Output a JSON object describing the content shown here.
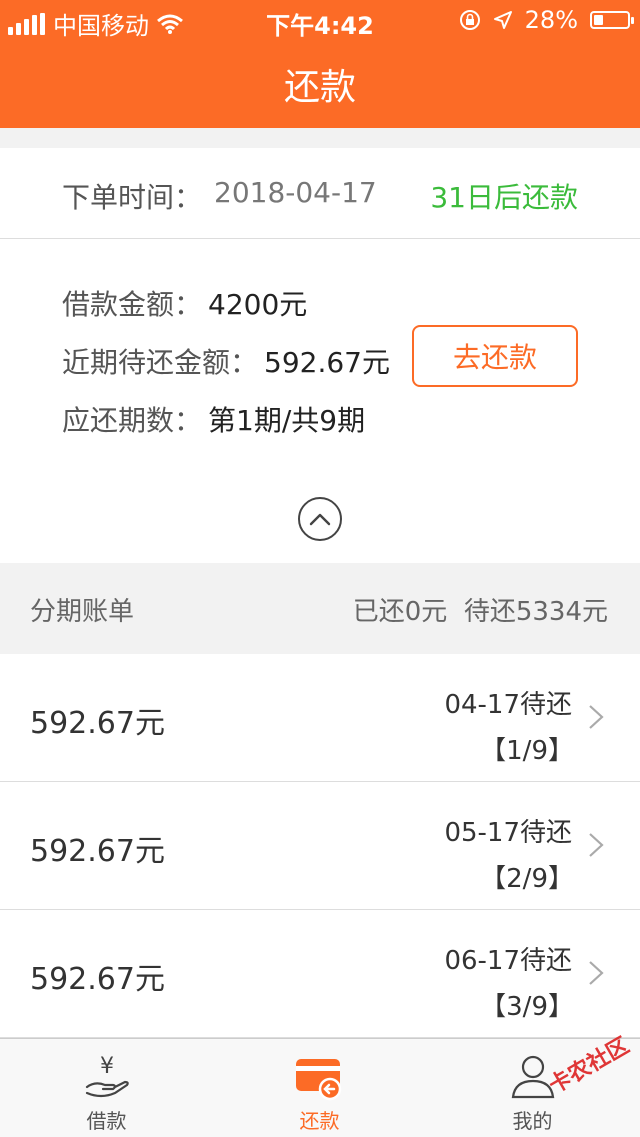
{
  "status_bar": {
    "carrier": "中国移动",
    "time": "下午4:42",
    "battery_pct": "28%",
    "battery_level": 0.28
  },
  "header": {
    "title": "还款"
  },
  "order": {
    "label": "下单时间：",
    "date": "2018-04-17",
    "due_text": "31日后还款"
  },
  "loan": {
    "amount_label": "借款金额：",
    "amount_value": "4200元",
    "recent_label": "近期待还金额：",
    "recent_value": "592.67元",
    "periods_label": "应还期数：",
    "periods_value": "第1期/共9期",
    "pay_button": "去还款"
  },
  "bill": {
    "title": "分期账单",
    "summary": "已还0元  待还5334元",
    "items": [
      {
        "amount": "592.67元",
        "date": "04-17待还",
        "period": "【1/9】"
      },
      {
        "amount": "592.67元",
        "date": "05-17待还",
        "period": "【2/9】"
      },
      {
        "amount": "592.67元",
        "date": "06-17待还",
        "period": "【3/9】"
      }
    ]
  },
  "tabs": [
    {
      "label": "借款",
      "icon": "loan-icon"
    },
    {
      "label": "还款",
      "icon": "repay-card-icon"
    },
    {
      "label": "我的",
      "icon": "user-icon"
    }
  ],
  "watermark": "卡农社区",
  "colors": {
    "accent": "#fc6b26",
    "due_green": "#3bbb3b"
  }
}
